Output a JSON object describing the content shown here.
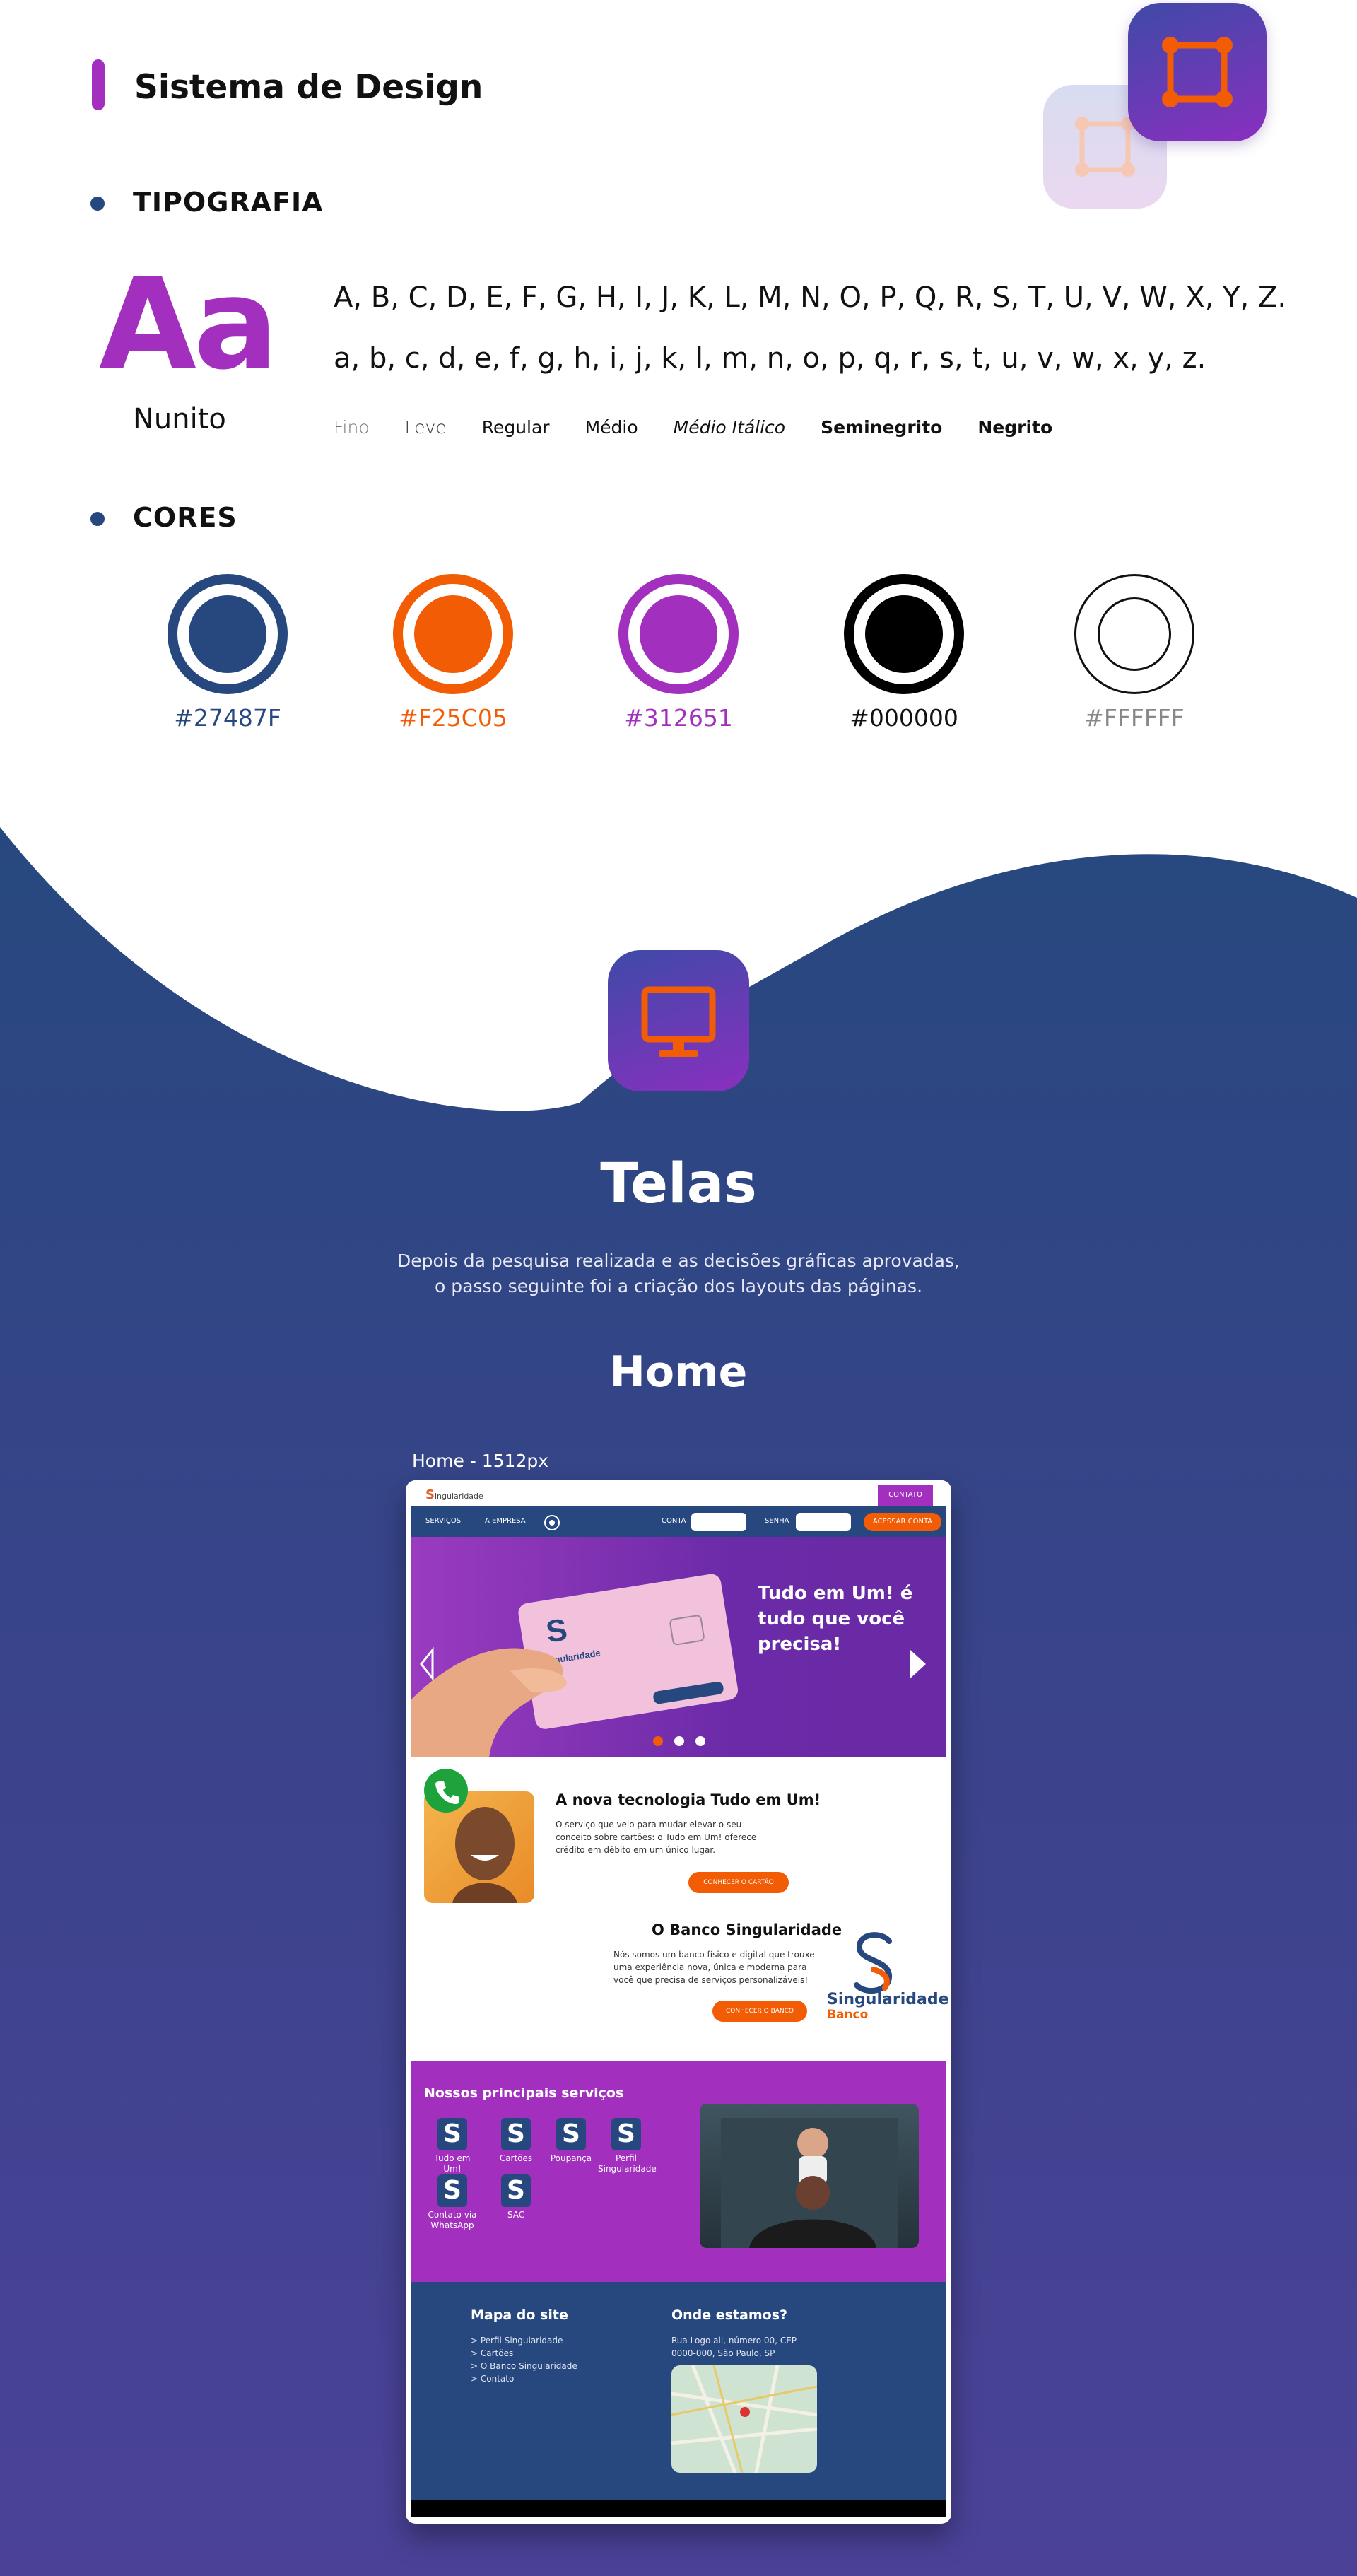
{
  "header": {
    "title": "Sistema de Design"
  },
  "typography": {
    "section_label": "TIPOGRAFIA",
    "sample": "Aa",
    "font_name": "Nunito",
    "uppercase": "A, B, C, D, E, F, G, H, I, J, K, L, M, N, O, P, Q, R, S, T, U, V, W, X, Y, Z.",
    "lowercase": "a, b, c, d, e, f, g, h, i, j, k, l, m, n, o, p, q, r, s, t, u, v, w, x, y, z.",
    "weights": [
      "Fino",
      "Leve",
      "Regular",
      "Médio",
      "Médio Itálico",
      "Seminegrito",
      "Negrito"
    ]
  },
  "colors": {
    "section_label": "CORES",
    "swatches": [
      {
        "hex": "#27487F",
        "color": "#27487f"
      },
      {
        "hex": "#F25C05",
        "color": "#f25c05"
      },
      {
        "hex": "#312651",
        "color": "#a22fbd"
      },
      {
        "hex": "#000000",
        "color": "#000000"
      },
      {
        "hex": "#FFFFFF",
        "color": "#ffffff"
      }
    ]
  },
  "screens": {
    "title": "Telas",
    "description": "Depois da pesquisa realizada e as decisões gráficas aprovadas, o passo seguinte foi a criação dos layouts das páginas.",
    "home_title": "Home",
    "frame_caption": "Home - 1512px"
  },
  "mockup": {
    "logo_initial": "S",
    "logo_text": "ingularidade",
    "contact_button": "CONTATO",
    "nav": {
      "services": "SERVIÇOS",
      "company": "A EMPRESA",
      "account": "CONTA",
      "password": "SENHA",
      "access_button": "ACESSAR CONTA"
    },
    "hero": {
      "headline": "Tudo em Um! é tudo que você precisa!",
      "card_brand": "Singularidade",
      "card_sub": "Banco"
    },
    "feature1": {
      "title": "A nova tecnologia Tudo em Um!",
      "text": "O serviço que veio para mudar elevar o seu conceito sobre cartões: o Tudo em Um! oferece crédito em débito em um único lugar.",
      "button": "CONHECER O CARTÃO"
    },
    "feature2": {
      "title": "O Banco Singularidade",
      "text": "Nós somos um banco físico e digital que trouxe uma experiência nova, única e moderna para você que precisa de serviços personalizáveis!",
      "button": "CONHECER O BANCO",
      "brand": "Singularidade",
      "brand_sub": "Banco"
    },
    "services": {
      "title": "Nossos principais serviços",
      "icon_letter": "S",
      "items": [
        "Tudo em Um!",
        "Cartões",
        "Poupança",
        "Perfil Singularidade",
        "Contato via WhatsApp",
        "SAC"
      ]
    },
    "footer": {
      "sitemap_title": "Mapa do site",
      "sitemap_links": [
        "> Perfil Singularidade",
        "> Cartões",
        "> O Banco Singularidade",
        "> Contato"
      ],
      "location_title": "Onde estamos?",
      "address_line1": "Rua Logo ali, número 00, CEP",
      "address_line2": "0000-000, São Paulo, SP"
    }
  }
}
